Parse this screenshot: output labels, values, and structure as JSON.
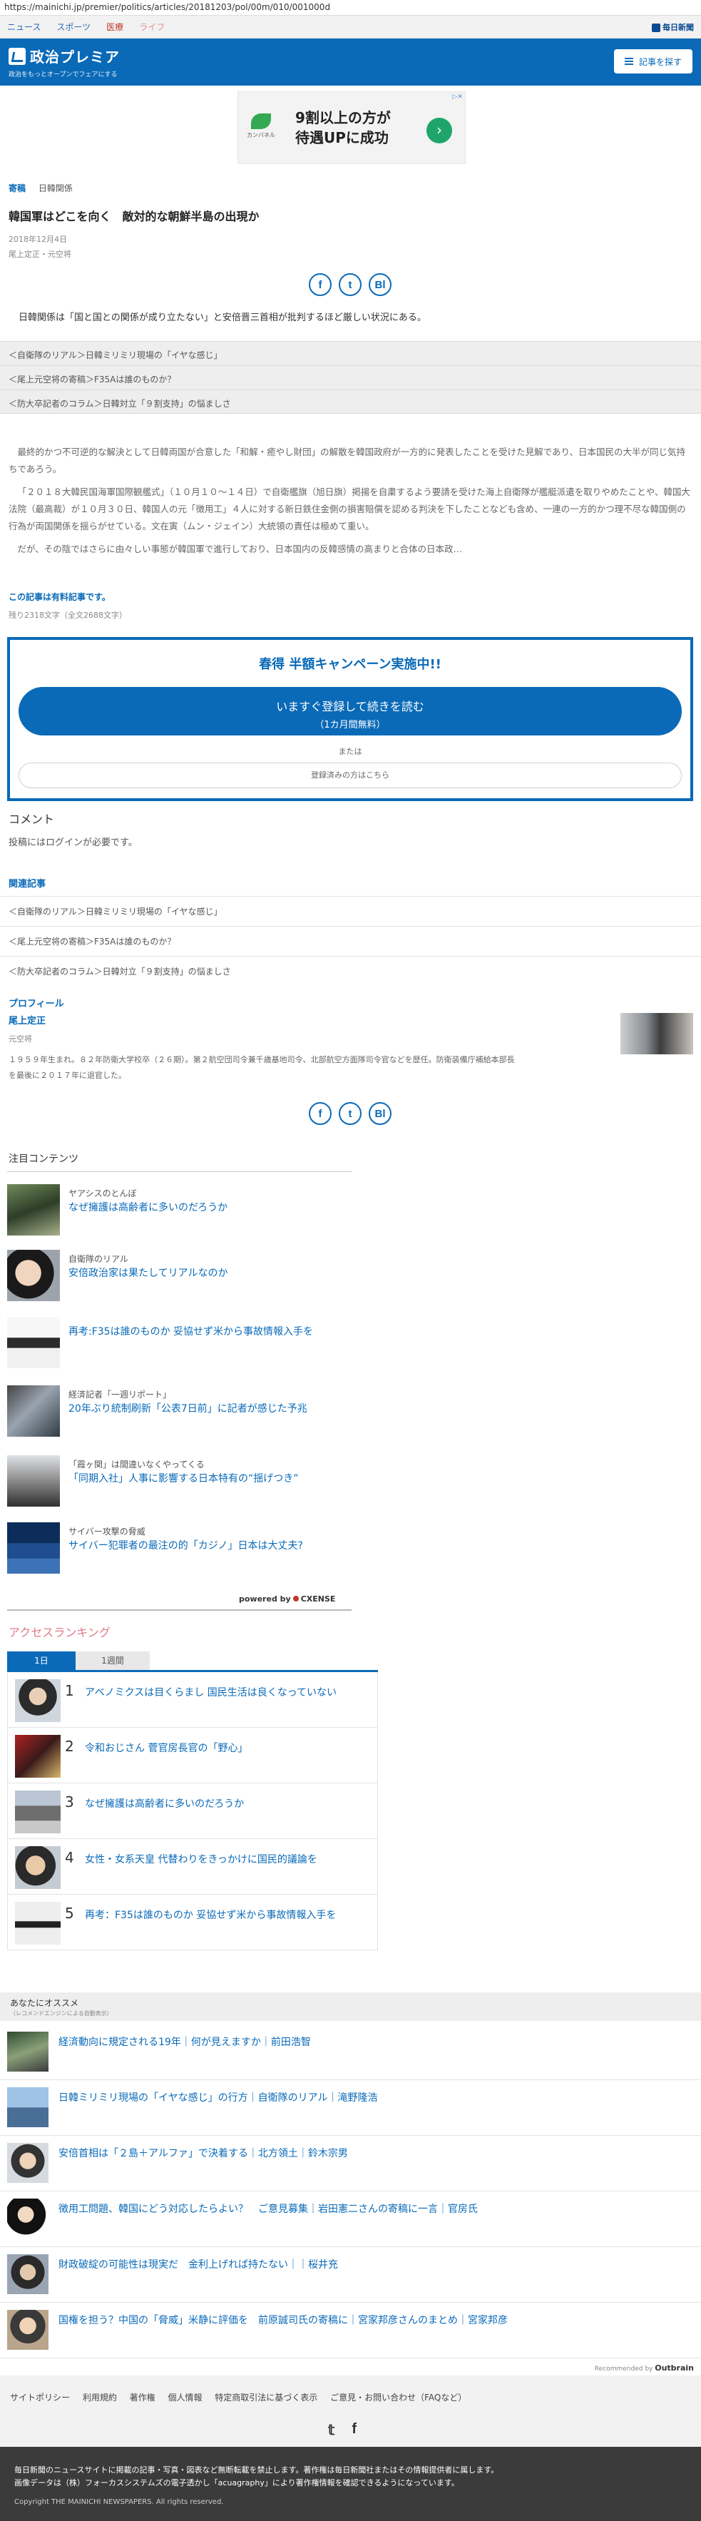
{
  "url": "https://mainichi.jp/premier/politics/articles/20181203/pol/00m/010/001000d",
  "topnav": {
    "items": [
      "ニュース",
      "スポーツ",
      "医療",
      "ライフ"
    ],
    "brand": "毎日新聞"
  },
  "header": {
    "title": "政治プレミア",
    "subtitle": "政治をもっとオープンでフェアにする",
    "search_label": "記事を探す"
  },
  "ad": {
    "line1": "9割以上の方が",
    "line2": "待遇UPに成功",
    "brand": "カンバネル",
    "arrow": "›",
    "close": "▷✕"
  },
  "breadcrumb": {
    "series": "寄稿",
    "category": "日韓関係"
  },
  "article": {
    "title": "韓国軍はどこを向く　敵対的な朝鮮半島の出現か",
    "date": "2018年12月4日",
    "author": "尾上定正・元空将",
    "lede": "日韓関係は「国と国との関係が成り立たない」と安倍晋三首相が批判するほど厳しい状況にある。",
    "series_links": [
      "＜自衛隊のリアル＞日韓ミリミリ現場の「イヤな感じ」",
      "＜尾上元空将の寄稿＞F35Aは誰のものか？",
      "＜防大卒記者のコラム＞日韓対立「９割支持」の悩ましさ"
    ],
    "paragraphs": [
      "最終的かつ不可逆的な解決として日韓両国が合意した「和解・癒やし財団」の解散を韓国政府が一方的に発表したことを受けた見解であり、日本国民の大半が同じ気持ちであろう。",
      "「２０１８大韓民国海軍国際観艦式」（１０月１０～１４日）で自衛艦旗（旭日旗）掲揚を自粛するよう要請を受けた海上自衛隊が艦艇派遣を取りやめたことや、韓国大法院（最高裁）が１０月３０日、韓国人の元「徴用工」４人に対する新日鉄住金側の損害賠償を認める判決を下したことなども含め、一連の一方的かつ理不尽な韓国側の行為が両国関係を揺らがせている。文在寅（ムン・ジェイン）大統領の責任は極めて重い。",
      "だが、その陰ではさらに由々しい事態が韓国軍で進行しており、日本国内の反韓感情の高まりと合体の日本政…"
    ],
    "paid_note": "この記事は有料記事です。",
    "remaining": "残り2318文字（全文2688文字）"
  },
  "share": {
    "facebook": "f",
    "twitter": "t",
    "bi": "Bl"
  },
  "campaign": {
    "title": "春得 半額キャンペーン実施中!!",
    "cta_line1": "いますぐ登録して続きを読む",
    "cta_line2": "（1カ月間無料）",
    "or": "または",
    "login": "登録済みの方はこちら"
  },
  "comments": {
    "heading": "コメント",
    "note": "投稿にはログインが必要です。"
  },
  "related": {
    "heading": "関連記事",
    "items": [
      "＜自衛隊のリアル＞日韓ミリミリ現場の「イヤな感じ」",
      "＜尾上元空将の寄稿＞F35Aは誰のものか？",
      "＜防大卒記者のコラム＞日韓対立「９割支持」の悩ましさ"
    ]
  },
  "profile": {
    "heading": "プロフィール",
    "name": "尾上定正",
    "title": "元空将",
    "bio_l1": "１９５９年生まれ。８２年防衛大学校卒（２６期）。第２航空団司令兼千歳基地司令、北部航空方面隊司令官などを歴任。防衛装備庁補給本部長",
    "bio_l2": "を最後に２０１７年に退官した。"
  },
  "attention": {
    "heading": "注目コンテンツ",
    "items": [
      {
        "category": "ヤアシスのとんぼ",
        "title": "なぜ擁護は高齢者に多いのだろうか"
      },
      {
        "category": "自衛隊のリアル",
        "title": "安倍政治家は果たしてリアルなのか"
      },
      {
        "category": "",
        "title": "再考:F35は誰のものか 妥協せず米から事故情報入手を"
      },
      {
        "category": "経済記者「一週リポート」",
        "title": "20年ぶり統制刷新「公表7日前」に記者が感じた予兆"
      },
      {
        "category": "「霞ヶ関」は間違いなくやってくる",
        "title": "「同期入社」人事に影響する日本特有の“揺げつき”"
      },
      {
        "category": "サイバー攻撃の脅威",
        "title": "サイバー犯罪者の最注の的「カジノ」日本は大丈夫?"
      }
    ],
    "powered_by": "powered by",
    "provider": "CXENSE"
  },
  "ranking": {
    "heading": "アクセスランキング",
    "tabs": [
      "1日",
      "1週間"
    ],
    "items": [
      {
        "rank": "1",
        "title": "アベノミクスは目くらまし 国民生活は良くなっていない"
      },
      {
        "rank": "2",
        "title": "令和おじさん 菅官房長官の「野心」"
      },
      {
        "rank": "3",
        "title": "なぜ擁護は高齢者に多いのだろうか"
      },
      {
        "rank": "4",
        "title": "女性・女系天皇 代替わりをきっかけに国民的議論を"
      },
      {
        "rank": "5",
        "title": "再考：F35は誰のものか 妥協せず米から事故情報入手を"
      }
    ]
  },
  "recommend": {
    "heading": "あなたにオススメ",
    "subheading": "（レコメンドエンジンによる自動表示）",
    "items": [
      "経済動向に規定される19年｜何が見えますか｜前田浩智",
      "日韓ミリミリ現場の「イヤな感じ」の行方｜自衛隊のリアル｜滝野隆浩",
      "安倍首相は「２島＋アルファ」で決着する｜北方領土｜鈴木宗男",
      "徴用工問題、韓国にどう対応したらよい？　ご意見募集｜岩田憲二さんの寄稿に一言｜官房氏",
      "財政破綻の可能性は現実だ　金利上げれば持たない｜｜桜井充",
      "国権を担う？中国の「脅威」米静に評価を　前原誠司氏の寄稿に｜宮家邦彦さんのまとめ｜宮家邦彦"
    ],
    "recommended_by": "Recommended by",
    "provider": "Outbrain"
  },
  "footer": {
    "links": "サイトポリシー 利用規約 著作権 個人情報 特定商取引法に基づく表示 ご意見・お問い合わせ（FAQなど）",
    "social": [
      "𝕥",
      "f"
    ],
    "notice1": "毎日新聞のニュースサイトに掲載の記事・写真・図表など無断転載を禁止します。著作権は毎日新聞社またはその情報提供者に属します。",
    "notice2": "画像データは（株）フォーカスシステムズの電子透かし「acuagraphy」により著作権情報を確認できるようになっています。",
    "copyright": "Copyright THE MAINICHI NEWSPAPERS. All rights reserved."
  }
}
